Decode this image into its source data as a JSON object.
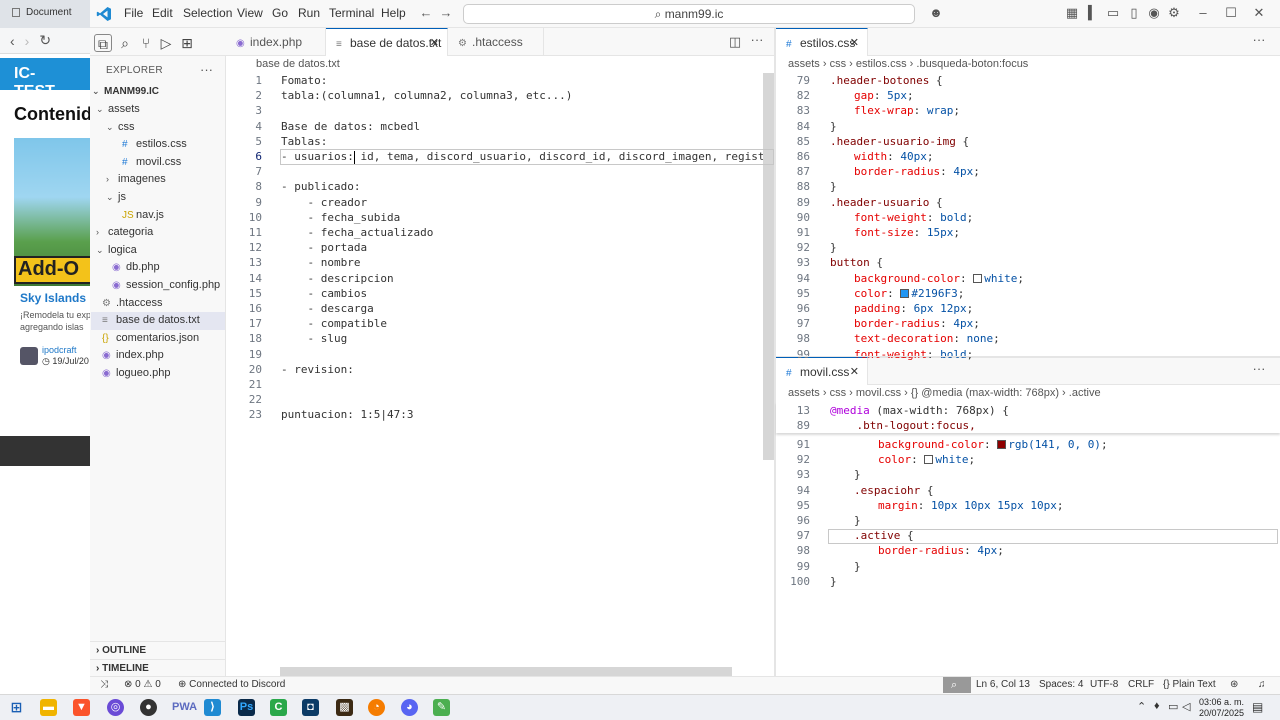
{
  "browser": {
    "tab_label": "Document",
    "site_name": "IC-TEST",
    "heading": "Contenido",
    "thumb_text": "Add-O",
    "card_title": "Sky Islands",
    "card_desc_1": "¡Remodela tu exp",
    "card_desc_2": "agregando islas",
    "author": "ipodcraft",
    "date": "19/Jul/20"
  },
  "titlebar": {
    "menus": [
      "File",
      "Edit",
      "Selection",
      "View",
      "Go",
      "Run",
      "Terminal",
      "Help"
    ],
    "search": "manm99.ic"
  },
  "sidebar": {
    "title": "EXPLORER",
    "root": "MANM99.IC",
    "items": [
      {
        "label": "assets",
        "type": "folder-open",
        "indent": 0
      },
      {
        "label": "css",
        "type": "folder-open",
        "indent": 1
      },
      {
        "label": "estilos.css",
        "type": "css",
        "indent": 2
      },
      {
        "label": "movil.css",
        "type": "css",
        "indent": 2
      },
      {
        "label": "imagenes",
        "type": "folder",
        "indent": 1
      },
      {
        "label": "js",
        "type": "folder-open",
        "indent": 1
      },
      {
        "label": "nav.js",
        "type": "js",
        "indent": 2
      },
      {
        "label": "categoria",
        "type": "folder",
        "indent": 0
      },
      {
        "label": "logica",
        "type": "folder-open",
        "indent": 0
      },
      {
        "label": "db.php",
        "type": "php",
        "indent": 1
      },
      {
        "label": "session_config.php",
        "type": "php",
        "indent": 1
      },
      {
        "label": ".htaccess",
        "type": "gear",
        "indent": 0
      },
      {
        "label": "base de datos.txt",
        "type": "txt",
        "indent": 0,
        "selected": true
      },
      {
        "label": "comentarios.json",
        "type": "json",
        "indent": 0
      },
      {
        "label": "index.php",
        "type": "php",
        "indent": 0
      },
      {
        "label": "logueo.php",
        "type": "php",
        "indent": 0
      }
    ],
    "outline": "OUTLINE",
    "timeline": "TIMELINE"
  },
  "tabs_left": [
    {
      "label": "index.php",
      "icon": "php"
    },
    {
      "label": "base de datos.txt",
      "icon": "txt",
      "active": true
    },
    {
      "label": ".htaccess",
      "icon": "gear"
    }
  ],
  "breadcrumb_left": "base de datos.txt",
  "left_code": [
    {
      "n": "1",
      "t": "Fomato:"
    },
    {
      "n": "2",
      "t": "tabla:(columna1, columna2, columna3, etc...)"
    },
    {
      "n": "3",
      "t": ""
    },
    {
      "n": "4",
      "t": "Base de datos: mcbedl"
    },
    {
      "n": "5",
      "t": "Tablas:"
    },
    {
      "n": "6",
      "t": "- usuarios: id, tema, discord_usuario, discord_id, discord_imagen, registrado_el"
    },
    {
      "n": "7",
      "t": ""
    },
    {
      "n": "8",
      "t": "- publicado:"
    },
    {
      "n": "9",
      "t": "    - creador"
    },
    {
      "n": "10",
      "t": "    - fecha_subida"
    },
    {
      "n": "11",
      "t": "    - fecha_actualizado"
    },
    {
      "n": "12",
      "t": "    - portada"
    },
    {
      "n": "13",
      "t": "    - nombre"
    },
    {
      "n": "14",
      "t": "    - descripcion"
    },
    {
      "n": "15",
      "t": "    - cambios"
    },
    {
      "n": "16",
      "t": "    - descarga"
    },
    {
      "n": "17",
      "t": "    - compatible"
    },
    {
      "n": "18",
      "t": "    - slug"
    },
    {
      "n": "19",
      "t": ""
    },
    {
      "n": "20",
      "t": "- revision:"
    },
    {
      "n": "21",
      "t": ""
    },
    {
      "n": "22",
      "t": ""
    },
    {
      "n": "23",
      "t": "puntuacion: 1:5|47:3"
    }
  ],
  "tabs_right": [
    {
      "label": "estilos.css",
      "icon": "css",
      "active": true
    }
  ],
  "breadcrumb_right": [
    "assets",
    "css",
    "estilos.css",
    ".busqueda-boton:focus"
  ],
  "right_code": [
    {
      "n": "79",
      "sel": ".header-botones",
      "brace": " {"
    },
    {
      "n": "82",
      "prop": "gap",
      "val": "5px"
    },
    {
      "n": "83",
      "prop": "flex-wrap",
      "val": "wrap"
    },
    {
      "n": "84",
      "close": "}"
    },
    {
      "n": "85",
      "sel": ".header-usuario-img",
      "brace": " {"
    },
    {
      "n": "86",
      "prop": "width",
      "val": "40px"
    },
    {
      "n": "87",
      "prop": "border-radius",
      "val": "4px"
    },
    {
      "n": "88",
      "close": "}"
    },
    {
      "n": "89",
      "sel": ".header-usuario",
      "brace": " {"
    },
    {
      "n": "90",
      "prop": "font-weight",
      "val": "bold"
    },
    {
      "n": "91",
      "prop": "font-size",
      "val": "15px"
    },
    {
      "n": "92",
      "close": "}"
    },
    {
      "n": "93",
      "sel": "button",
      "brace": " {"
    },
    {
      "n": "94",
      "prop": "background-color",
      "val": "white",
      "swatch": "#ffffff"
    },
    {
      "n": "95",
      "prop": "color",
      "val": "#2196F3",
      "swatch": "#2196f3"
    },
    {
      "n": "96",
      "prop": "padding",
      "val": "6px 12px"
    },
    {
      "n": "97",
      "prop": "border-radius",
      "val": "4px"
    },
    {
      "n": "98",
      "prop": "text-decoration",
      "val": "none"
    },
    {
      "n": "99",
      "prop": "font-weight",
      "val": "bold"
    }
  ],
  "tabs_right2": [
    {
      "label": "movil.css",
      "icon": "css",
      "active": true
    }
  ],
  "breadcrumb_right2": [
    "assets",
    "css",
    "movil.css",
    "{} @media (max-width: 768px)",
    ".active"
  ],
  "sticky_right2": [
    {
      "n": "13",
      "at": "@media",
      "rest": " (max-width: 768px) {"
    },
    {
      "n": "89",
      "sel": "    .btn-logout:focus,"
    }
  ],
  "right2_code": [
    {
      "n": "91",
      "prop": "background-color",
      "val": "rgb(141, 0, 0)",
      "swatch": "#8d0000",
      "indent": 2
    },
    {
      "n": "92",
      "prop": "color",
      "val": "white",
      "swatch": "#ffffff",
      "indent": 2
    },
    {
      "n": "93",
      "close": "}",
      "indent": 1
    },
    {
      "n": "94",
      "sel": ".espaciohr",
      "brace": " {",
      "indent": 1
    },
    {
      "n": "95",
      "prop": "margin",
      "val": "10px 10px 15px 10px",
      "indent": 2
    },
    {
      "n": "96",
      "close": "}",
      "indent": 1
    },
    {
      "n": "97",
      "sel": ".active",
      "brace": " {",
      "indent": 1
    },
    {
      "n": "98",
      "prop": "border-radius",
      "val": "4px",
      "indent": 2
    },
    {
      "n": "99",
      "close": "}",
      "indent": 1
    },
    {
      "n": "100",
      "close": "}",
      "indent": 0
    }
  ],
  "statusbar": {
    "errors": "0",
    "warnings": "0",
    "discord": "Connected to Discord",
    "position": "Ln 6, Col 13",
    "spaces": "Spaces: 4",
    "encoding": "UTF-8",
    "eol": "CRLF",
    "language": "Plain Text"
  },
  "taskbar": {
    "time": "03:06 a. m.",
    "date": "20/07/2025"
  },
  "colors": {
    "accent": "#005fb8",
    "selector": "#800000",
    "property": "#e50000",
    "value": "#0451a5",
    "at_rule": "#af00db"
  }
}
